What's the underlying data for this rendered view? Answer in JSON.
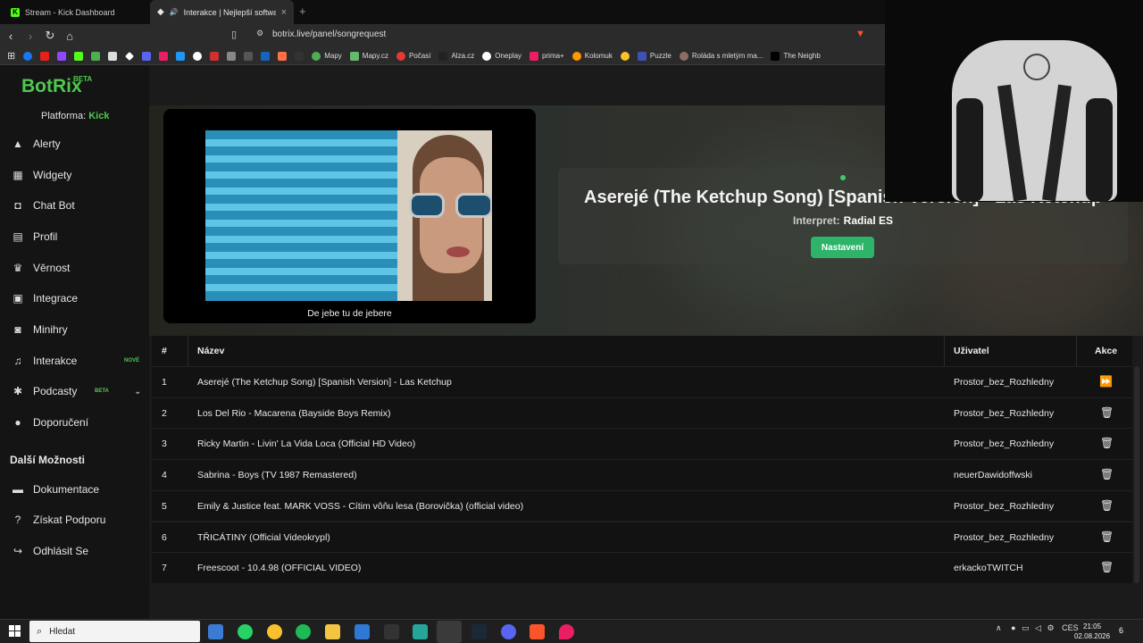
{
  "browser": {
    "tabs": [
      {
        "title": "Stream - Kick Dashboard"
      },
      {
        "title": "Interakce | Nejlepší software p"
      }
    ],
    "url": "botrix.live/panel/songrequest",
    "bookmarks": [
      "Mapy",
      "Mapy.cz",
      "Počasí",
      "Alza.cz",
      "Oneplay",
      "prima+",
      "Kolomuk",
      "Puzzle",
      "Roláda s mletým ma...",
      "The Neighb"
    ]
  },
  "app": {
    "logo": "BotRix",
    "logo_badge": "BETA",
    "platform_label": "Platforma:",
    "platform_value": "Kick",
    "nav": [
      {
        "label": "Alerty",
        "icon": "warning-icon"
      },
      {
        "label": "Widgety",
        "icon": "widgets-icon"
      },
      {
        "label": "Chat Bot",
        "icon": "robot-icon"
      },
      {
        "label": "Profil",
        "icon": "id-card-icon"
      },
      {
        "label": "Věrnost",
        "icon": "trophy-icon"
      },
      {
        "label": "Integrace",
        "icon": "integration-icon"
      },
      {
        "label": "Minihry",
        "icon": "gamepad-icon"
      },
      {
        "label": "Interakce",
        "icon": "music-icon",
        "badge": "NOVÉ"
      },
      {
        "label": "Podcasty",
        "icon": "podcast-icon",
        "badge": "BETA"
      },
      {
        "label": "Doporučení",
        "icon": "users-icon"
      }
    ],
    "more_section": "Další Možnosti",
    "more": [
      {
        "label": "Dokumentace",
        "icon": "docs-icon"
      },
      {
        "label": "Získat Podporu",
        "icon": "help-icon"
      },
      {
        "label": "Odhlásit Se",
        "icon": "logout-icon"
      }
    ]
  },
  "player": {
    "caption": "De jebe tu de jebere",
    "now_playing": "Aserejé (The Ketchup Song) [Spanish Version] - Las Ketchup",
    "interpret_label": "Interpret:",
    "interpret": "Radial ES",
    "settings_label": "Nastavení"
  },
  "table": {
    "headers": {
      "num": "#",
      "name": "Název",
      "user": "Uživatel",
      "action": "Akce"
    },
    "rows": [
      {
        "n": "1",
        "name": "Aserejé (The Ketchup Song) [Spanish Version] - Las Ketchup",
        "user": "Prostor_bez_Rozhledny",
        "action": "skip"
      },
      {
        "n": "2",
        "name": "Los Del Rio - Macarena (Bayside Boys Remix)",
        "user": "Prostor_bez_Rozhledny",
        "action": "delete"
      },
      {
        "n": "3",
        "name": "Ricky Martin - Livin' La Vida Loca (Official HD Video)",
        "user": "Prostor_bez_Rozhledny",
        "action": "delete"
      },
      {
        "n": "4",
        "name": "Sabrina - Boys (TV 1987 Remastered)",
        "user": "neuerDawidoffwski",
        "action": "delete"
      },
      {
        "n": "5",
        "name": "Emily & Justice feat. MARK VOSS - Cítim vôňu lesa (Borovička) (official video)",
        "user": "Prostor_bez_Rozhledny",
        "action": "delete"
      },
      {
        "n": "6",
        "name": "TŘICÁTINY (Official Videokrypl)",
        "user": "Prostor_bez_Rozhledny",
        "action": "delete"
      },
      {
        "n": "7",
        "name": "Freescoot - 10.4.98 (OFFICIAL VIDEO)",
        "user": "erkackoTWITCH",
        "action": "delete"
      }
    ]
  },
  "taskbar": {
    "search_placeholder": "Hledat",
    "lang": "CES",
    "time": "21:05",
    "date": "02.08.2026",
    "notifications": "6"
  },
  "colors": {
    "brand": "#4ec94e",
    "button": "#2db36a"
  }
}
